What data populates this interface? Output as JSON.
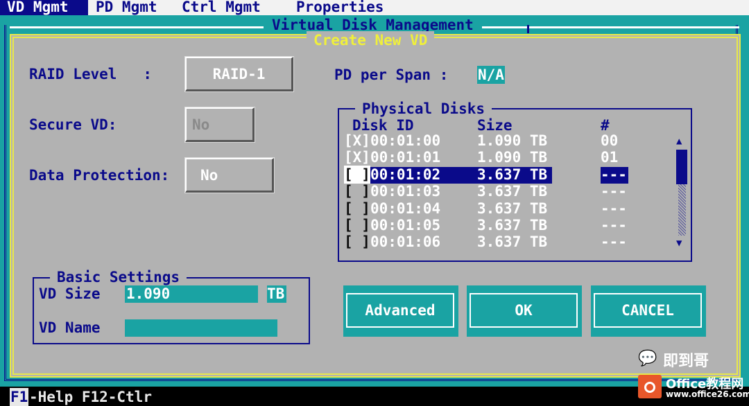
{
  "menu": {
    "items": [
      "VD Mgmt",
      "PD Mgmt",
      "Ctrl Mgmt",
      "Properties"
    ]
  },
  "window": {
    "title": "Virtual Disk Management"
  },
  "dialog": {
    "title": "Create New VD",
    "raid_level_label": "RAID Level   :",
    "raid_level_value": "RAID-1",
    "secure_vd_label": "Secure VD:",
    "secure_vd_value": "No",
    "data_protection_label": "Data Protection:",
    "data_protection_value": "No",
    "pd_per_span_label": "PD per Span :",
    "pd_per_span_value": "N/A"
  },
  "physical_disks": {
    "title": "Physical Disks",
    "headers": [
      "Disk ID",
      "Size",
      "#"
    ],
    "rows": [
      {
        "check": "[X]",
        "id": "00:01:00",
        "size": "1.090 TB",
        "num": "00"
      },
      {
        "check": "[X]",
        "id": "00:01:01",
        "size": "1.090 TB",
        "num": "01"
      },
      {
        "check": "[ ]",
        "id": "00:01:02",
        "size": "3.637 TB",
        "num": "---"
      },
      {
        "check": "[ ]",
        "id": "00:01:03",
        "size": "3.637 TB",
        "num": "---"
      },
      {
        "check": "[ ]",
        "id": "00:01:04",
        "size": "3.637 TB",
        "num": "---"
      },
      {
        "check": "[ ]",
        "id": "00:01:05",
        "size": "3.637 TB",
        "num": "---"
      },
      {
        "check": "[ ]",
        "id": "00:01:06",
        "size": "3.637 TB",
        "num": "---"
      }
    ],
    "selected_index": 2,
    "scroll_up_glyph": "▲",
    "scroll_down_glyph": "▼"
  },
  "basic_settings": {
    "title": "Basic Settings",
    "vd_size_label": "VD Size",
    "vd_size_value": "1.090",
    "vd_size_unit": "TB",
    "vd_name_label": "VD Name",
    "vd_name_value": ""
  },
  "buttons": {
    "advanced": "Advanced",
    "ok": "OK",
    "cancel": "CANCEL"
  },
  "status": {
    "f1": "F1",
    "rest": "-Help F12-Ctlr"
  },
  "watermark": {
    "chat_glyph": "💬",
    "name": "即到哥",
    "office": "Office教程网",
    "url": "www.office26.com"
  },
  "colors": {
    "background_cyan": "#1aa3a3",
    "dialog_gray": "#b2b2b2",
    "text_blue": "#0a0a8a",
    "dialog_border_yellow": "#e8e84a",
    "highlight_cyan": "#1aa3a3",
    "selection_blue": "#0a0a8a"
  }
}
